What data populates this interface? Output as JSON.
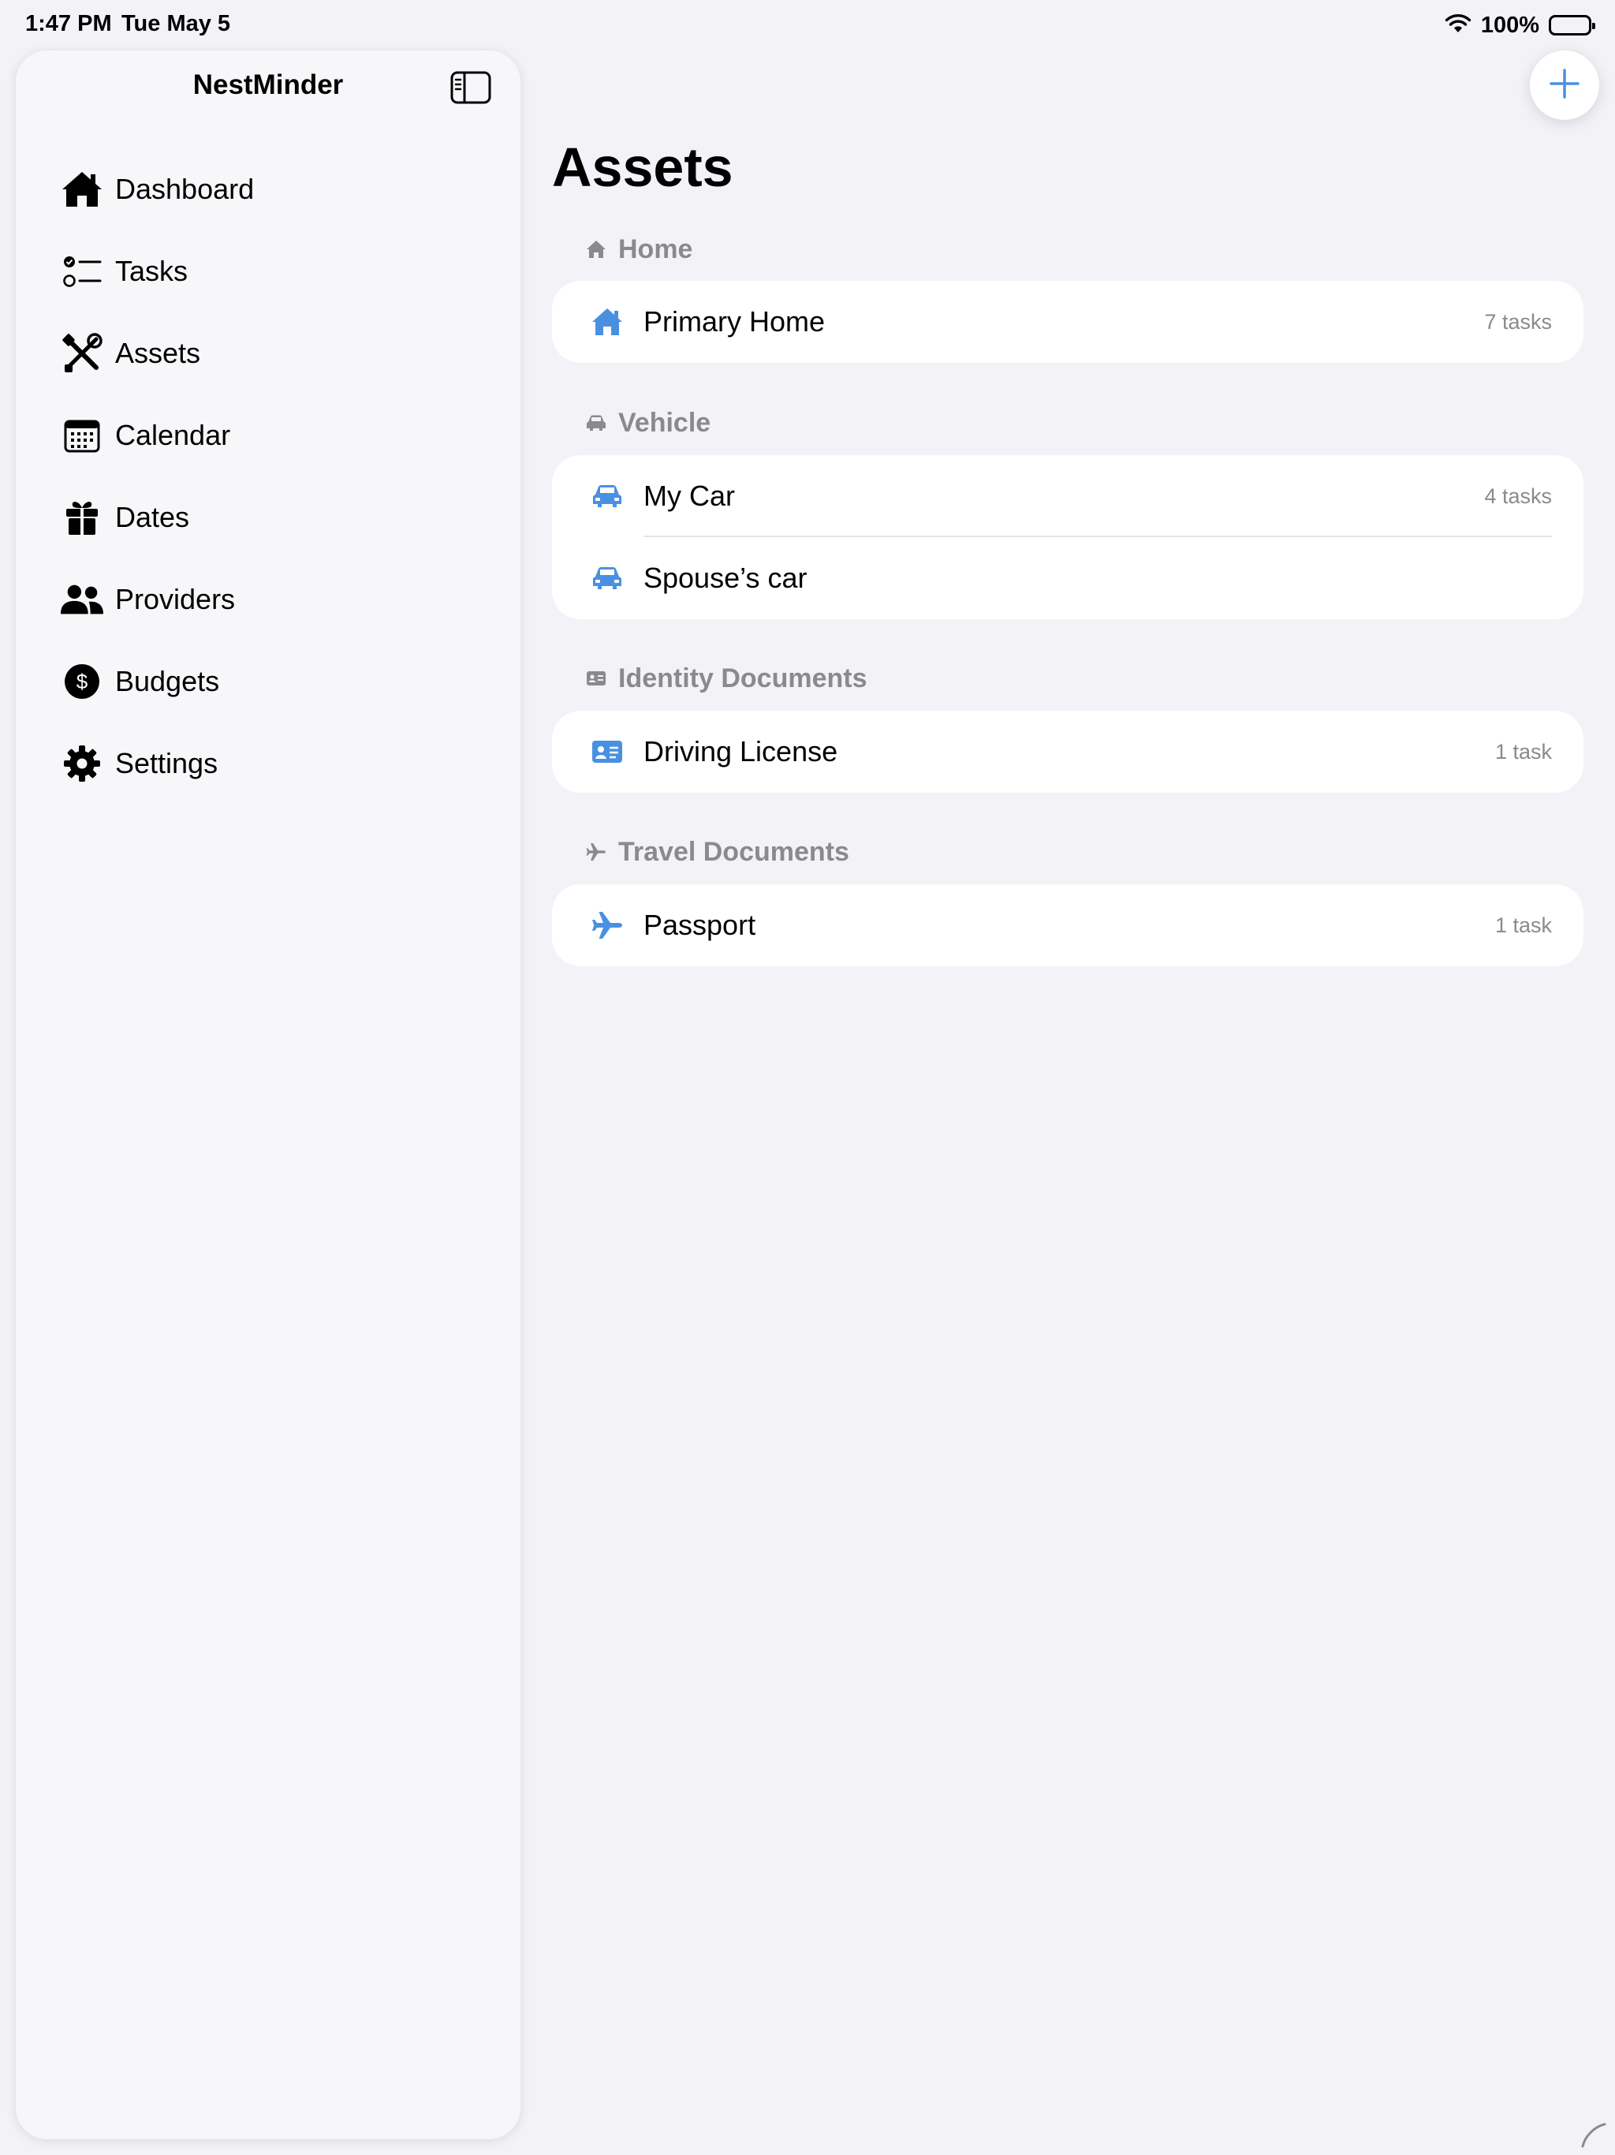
{
  "status_bar": {
    "time": "1:47 PM",
    "date": "Tue May 5",
    "battery_percent": "100%",
    "icons": [
      "wifi-icon",
      "battery-icon"
    ]
  },
  "sidebar": {
    "title": "NestMinder",
    "toggle_icon": "sidebar-toggle-icon",
    "items": [
      {
        "label": "Dashboard",
        "icon": "house-icon"
      },
      {
        "label": "Tasks",
        "icon": "checklist-icon"
      },
      {
        "label": "Assets",
        "icon": "tools-icon"
      },
      {
        "label": "Calendar",
        "icon": "calendar-icon"
      },
      {
        "label": "Dates",
        "icon": "gift-icon"
      },
      {
        "label": "Providers",
        "icon": "people-icon"
      },
      {
        "label": "Budgets",
        "icon": "dollar-icon"
      },
      {
        "label": "Settings",
        "icon": "gear-icon"
      }
    ]
  },
  "main": {
    "title": "Assets",
    "add_icon": "plus-icon",
    "sections": [
      {
        "header": "Home",
        "icon": "house-icon",
        "items": [
          {
            "label": "Primary Home",
            "count": "7 tasks",
            "icon": "house-icon"
          }
        ]
      },
      {
        "header": "Vehicle",
        "icon": "car-icon",
        "items": [
          {
            "label": "My Car",
            "count": "4 tasks",
            "icon": "car-icon"
          },
          {
            "label": "Spouse’s car",
            "count": "",
            "icon": "car-icon"
          }
        ]
      },
      {
        "header": "Identity Documents",
        "icon": "id-card-icon",
        "items": [
          {
            "label": "Driving License",
            "count": "1 task",
            "icon": "id-card-icon"
          }
        ]
      },
      {
        "header": "Travel Documents",
        "icon": "airplane-icon",
        "items": [
          {
            "label": "Passport",
            "count": "1 task",
            "icon": "airplane-icon"
          }
        ]
      }
    ]
  },
  "colors": {
    "accent": "#4a90e2",
    "background": "#f2f2f7",
    "sidebar_bg": "#f7f7fa",
    "secondary_text": "#8a8a8e"
  }
}
